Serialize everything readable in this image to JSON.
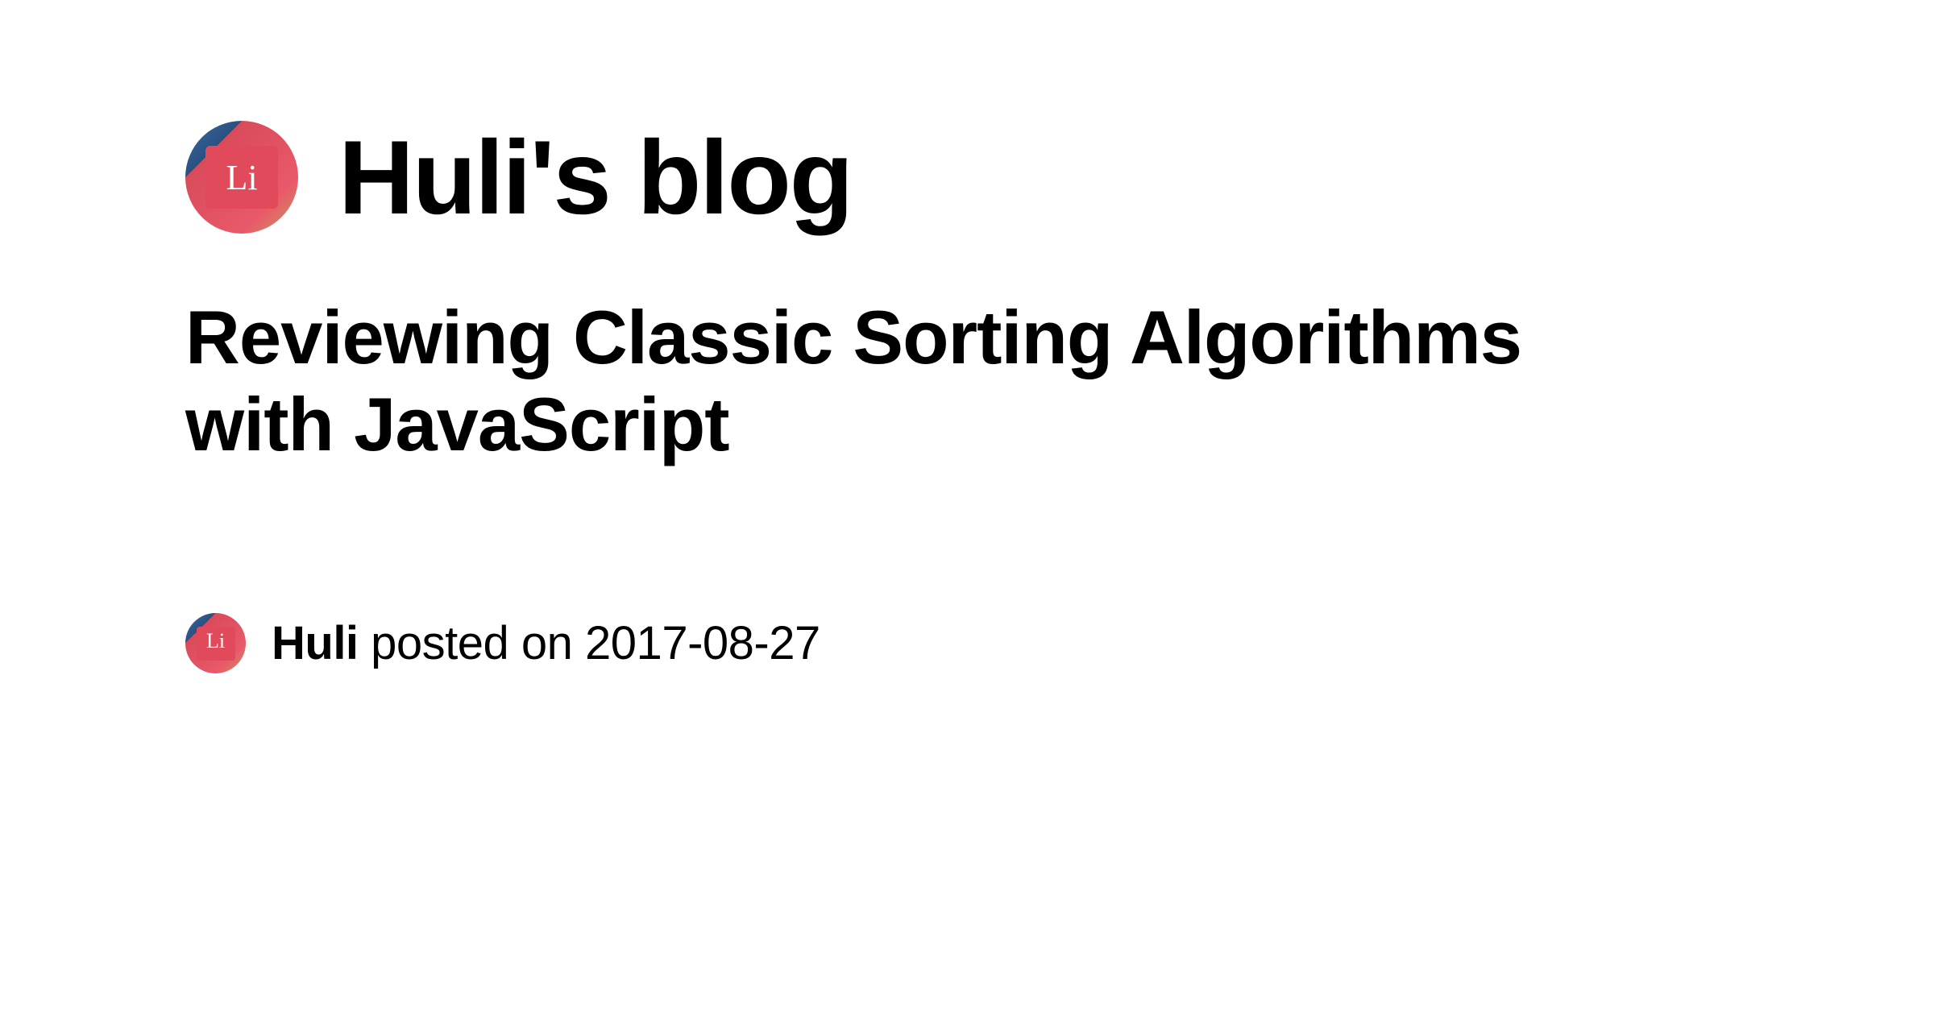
{
  "blog": {
    "title": "Huli's blog"
  },
  "post": {
    "title": "Reviewing Classic Sorting Algorithms with JavaScript"
  },
  "meta": {
    "author": "Huli",
    "posted_label": " posted on ",
    "date": "2017-08-27"
  }
}
